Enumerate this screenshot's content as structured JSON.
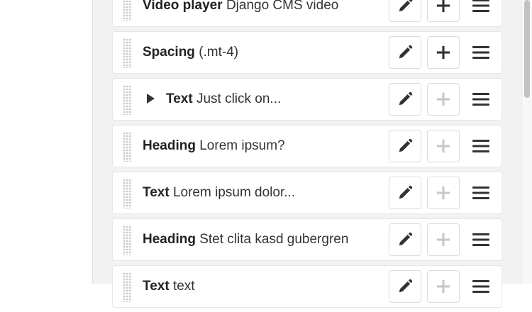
{
  "structure": {
    "items": [
      {
        "type": "Video player",
        "summary": "Django CMS video",
        "expandable": false,
        "add_enabled": true
      },
      {
        "type": "Spacing",
        "summary": "(.mt-4)",
        "expandable": false,
        "add_enabled": true
      },
      {
        "type": "Text",
        "summary": "Just click on...",
        "expandable": true,
        "add_enabled": false
      },
      {
        "type": "Heading",
        "summary": "Lorem ipsum?",
        "expandable": false,
        "add_enabled": false
      },
      {
        "type": "Text",
        "summary": "Lorem ipsum dolor...",
        "expandable": false,
        "add_enabled": false
      },
      {
        "type": "Heading",
        "summary": "Stet clita kasd gubergren",
        "expandable": false,
        "add_enabled": false
      },
      {
        "type": "Text",
        "summary": "text",
        "expandable": false,
        "add_enabled": false
      }
    ]
  },
  "icons": {
    "edit": "pencil-icon",
    "add": "plus-icon",
    "menu": "hamburger-menu-icon",
    "expand": "caret-right-icon",
    "drag": "drag-handle-icon"
  },
  "colors": {
    "panel_background": "#f2f2f2",
    "row_background": "#ffffff",
    "icon_active": "#333333",
    "icon_disabled": "#c8c8c8"
  }
}
